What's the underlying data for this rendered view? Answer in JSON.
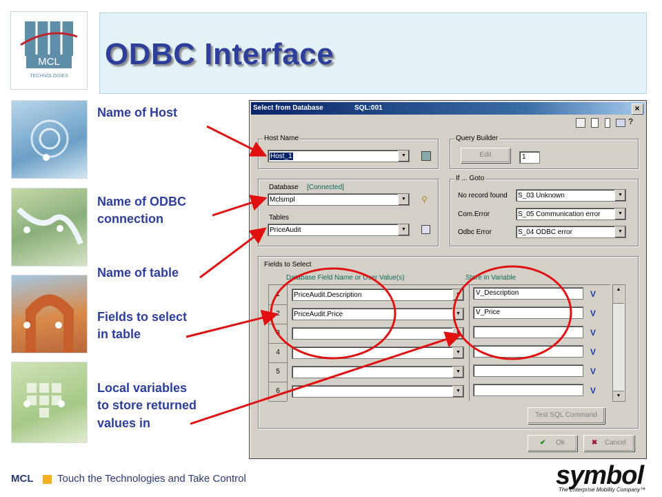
{
  "logo": {
    "text": "MCL",
    "subtext": "TECHNOLOGIES"
  },
  "title": "ODBC Interface",
  "labels": {
    "host": "Name of Host",
    "odbc_line1": "Name of ODBC",
    "odbc_line2": "connection",
    "table": "Name of table",
    "fields_line1": "Fields to select",
    "fields_line2": "in table",
    "vars_line1": "Local variables",
    "vars_line2": "to store returned",
    "vars_line3": "values in"
  },
  "dialog": {
    "title": "Select from Database",
    "sql_id": "SQL:001",
    "close": "×",
    "host_group": "Host Name",
    "host_value": "Host_1",
    "query_group": "Query Builder",
    "edit_button": "Edit",
    "query_count": "1",
    "database_label": "Database",
    "connection_status": "[Connected]",
    "database_value": "Mclsmpl",
    "tables_label": "Tables",
    "tables_value": "PriceAudit",
    "ifgoto_group": "If ... Goto",
    "no_record_label": "No record found",
    "no_record_value": "S_03 Unknown",
    "com_error_label": "Com.Error",
    "com_error_value": "S_05 Communication error",
    "odbc_error_label": "Odbc Error",
    "odbc_error_value": "S_04 ODBC error",
    "fields_group": "Fields to Select",
    "col_field": "Database Field Name or User Value(s)",
    "col_var": "Store in Variable",
    "rows": [
      {
        "num": "1",
        "field": "PriceAudit.Description",
        "var": "V_Description"
      },
      {
        "num": "2",
        "field": "PriceAudit.Price",
        "var": "V_Price"
      },
      {
        "num": "3",
        "field": "",
        "var": ""
      },
      {
        "num": "4",
        "field": "",
        "var": ""
      },
      {
        "num": "5",
        "field": "",
        "var": ""
      },
      {
        "num": "6",
        "field": "",
        "var": ""
      }
    ],
    "test_button": "Test SQL Command",
    "ok_button": "Ok",
    "cancel_button": "Cancel"
  },
  "footer": {
    "brand": "MCL",
    "tagline": "Touch the Technologies and Take Control",
    "partner_logo": "symbol",
    "partner_tagline": "The Enterprise Mobility Company™"
  },
  "colors": {
    "title": "#2d3f9a",
    "arrows": "#e01010",
    "accent_square": "#f0b020",
    "dialog_bg": "#d4d0c8"
  }
}
